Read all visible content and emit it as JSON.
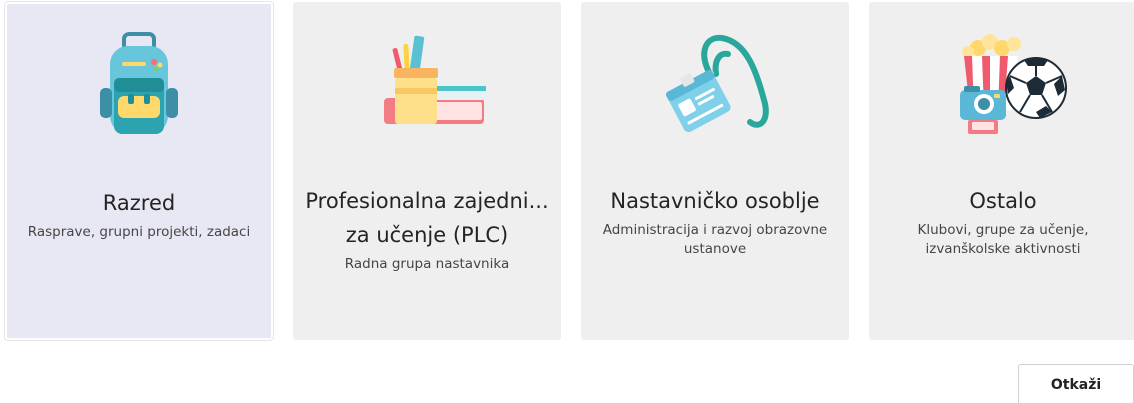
{
  "cards": [
    {
      "title": "Razred",
      "description": "Rasprave, grupni projekti, zadaci",
      "icon": "backpack-icon",
      "selected": true
    },
    {
      "title_line1": "Profesionalna zajedni...",
      "title_line2": "za učenje (PLC)",
      "description": "Radna grupa nastavnika",
      "icon": "books-pencils-icon"
    },
    {
      "title": "Nastavničko osoblje",
      "description_line1": "Administracija i razvoj obrazovne",
      "description_line2": "ustanove",
      "icon": "id-badge-lanyard-icon"
    },
    {
      "title": "Ostalo",
      "description_line1": "Klubovi, grupe za učenje,",
      "description_line2": "izvanškolske aktivnosti",
      "icon": "popcorn-camera-ball-icon"
    }
  ],
  "actions": {
    "cancel_label": "Otkaži"
  },
  "colors": {
    "card_bg": "#efefef",
    "selected_card_bg": "#e8e8f4",
    "text_primary": "#252423",
    "text_secondary": "#484644"
  }
}
